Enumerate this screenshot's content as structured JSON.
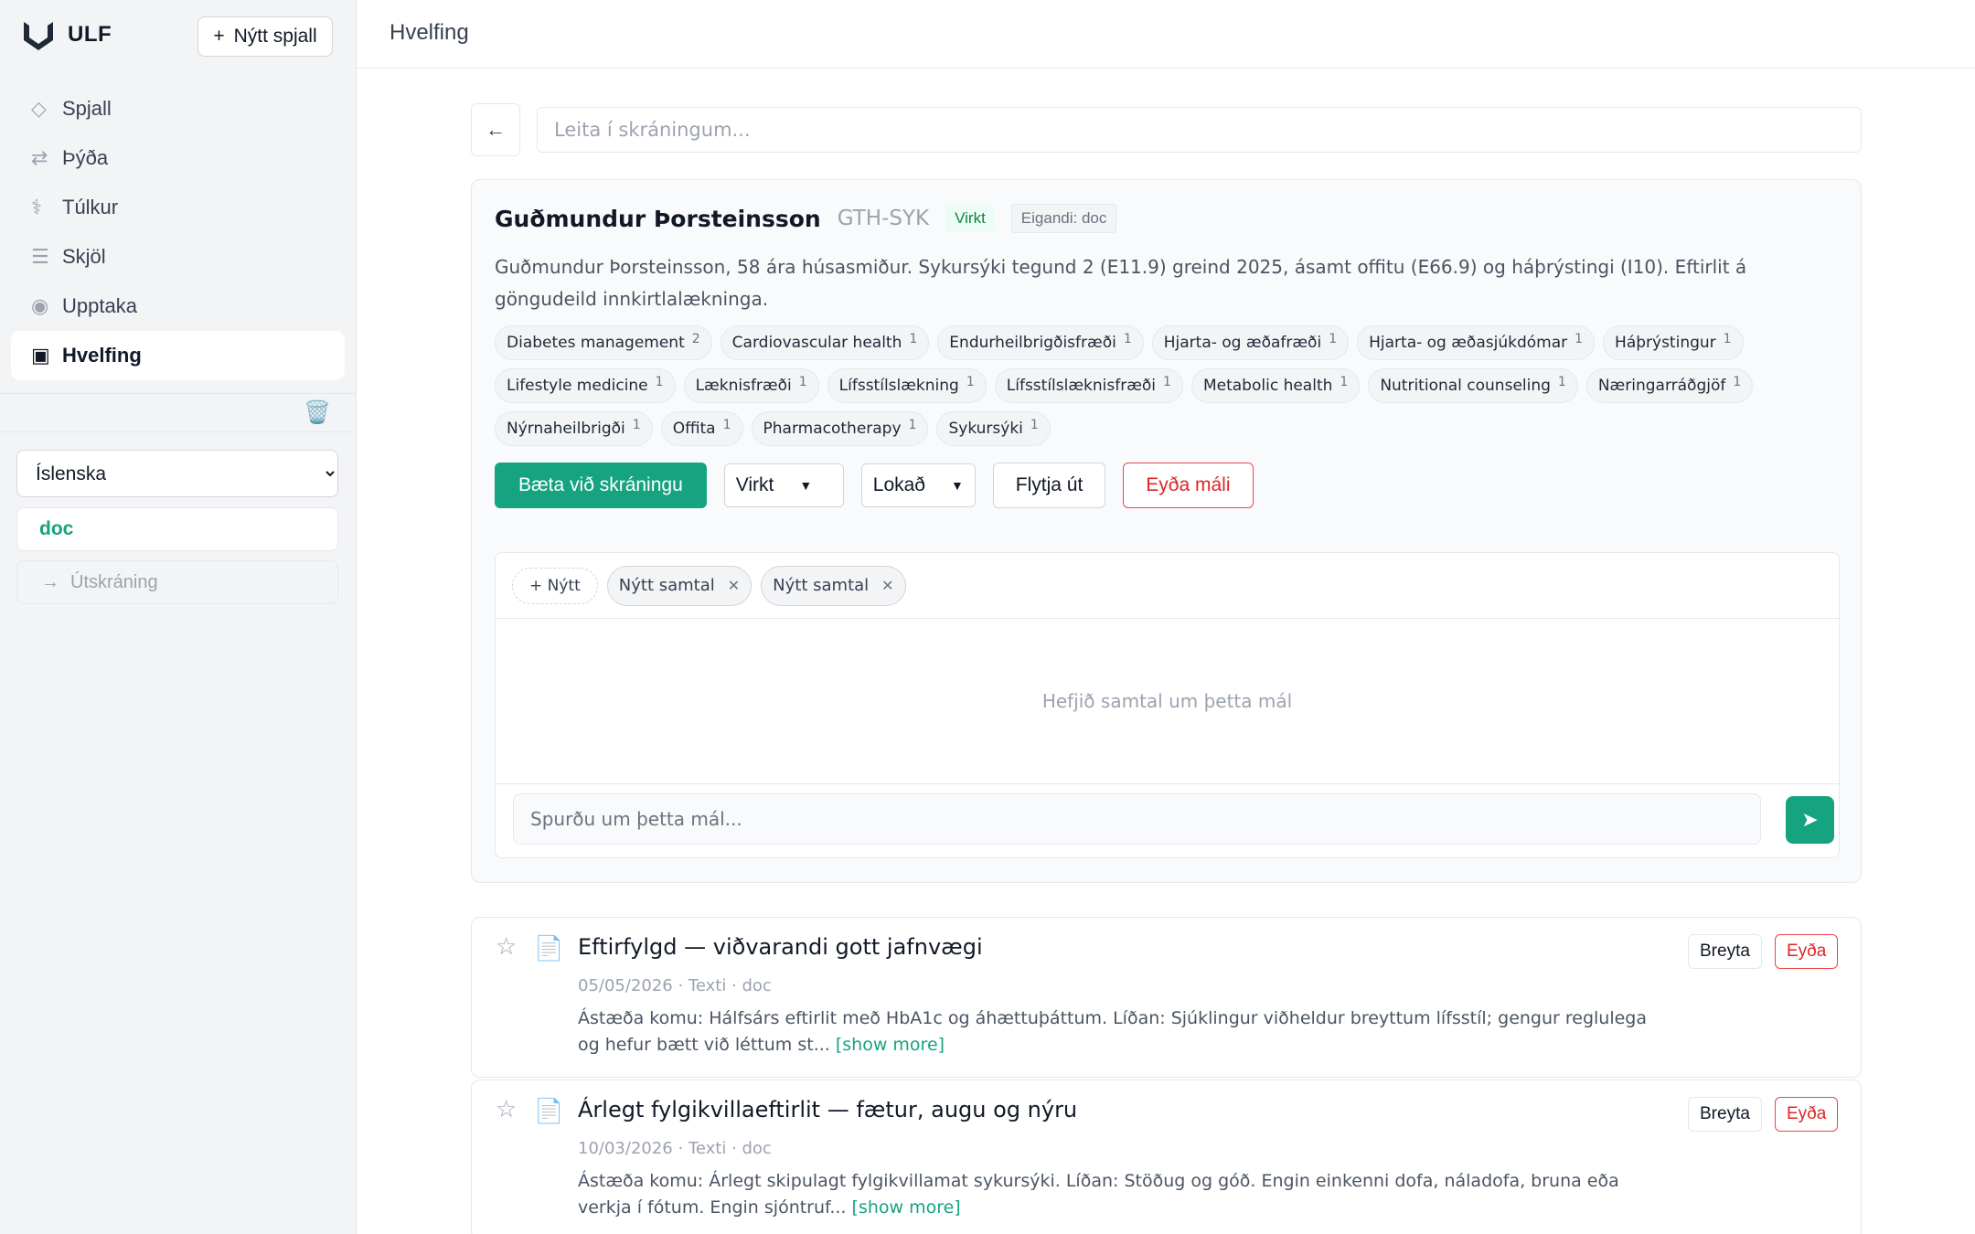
{
  "sidebar": {
    "brand": "ULF",
    "new_chat": "Nýtt spjall",
    "items": [
      {
        "label": "Spjall",
        "icon": "◇"
      },
      {
        "label": "Þýða",
        "icon": "⇄"
      },
      {
        "label": "Túlkur",
        "icon": "⚕"
      },
      {
        "label": "Skjöl",
        "icon": "☰"
      },
      {
        "label": "Upptaka",
        "icon": "◉"
      },
      {
        "label": "Hvelfing",
        "icon": "▣"
      }
    ],
    "language": "Íslenska",
    "user": "doc",
    "logout": "Útskráning"
  },
  "header": {
    "title": "Hvelfing"
  },
  "search": {
    "placeholder": "Leita í skráningum..."
  },
  "case": {
    "name": "Guðmundur Þorsteinsson",
    "code": "GTH-SYK",
    "status": "Virkt",
    "owner": "Eigandi: doc",
    "description": "Guðmundur Þorsteinsson, 58 ára húsasmiður. Sykursýki tegund 2 (E11.9) greind 2025, ásamt offitu (E66.9) og háþrýstingi (I10). Eftirlit á göngudeild innkirtlalækninga.",
    "tags": [
      {
        "label": "Diabetes management",
        "count": "2"
      },
      {
        "label": "Cardiovascular health",
        "count": "1"
      },
      {
        "label": "Endurheilbrigðisfræði",
        "count": "1"
      },
      {
        "label": "Hjarta- og æðafræði",
        "count": "1"
      },
      {
        "label": "Hjarta- og æðasjúkdómar",
        "count": "1"
      },
      {
        "label": "Háþrýstingur",
        "count": "1"
      },
      {
        "label": "Lifestyle medicine",
        "count": "1"
      },
      {
        "label": "Læknisfræði",
        "count": "1"
      },
      {
        "label": "Lífsstílslækning",
        "count": "1"
      },
      {
        "label": "Lífsstílslæknisfræði",
        "count": "1"
      },
      {
        "label": "Metabolic health",
        "count": "1"
      },
      {
        "label": "Nutritional counseling",
        "count": "1"
      },
      {
        "label": "Næringarráðgjöf",
        "count": "1"
      },
      {
        "label": "Nýrnaheilbrigði",
        "count": "1"
      },
      {
        "label": "Offita",
        "count": "1"
      },
      {
        "label": "Pharmacotherapy",
        "count": "1"
      },
      {
        "label": "Sykursýki",
        "count": "1"
      }
    ],
    "actions": {
      "add_entry": "Bæta við skráningu",
      "status_select": "Virkt",
      "access_select": "Lokað",
      "export": "Flytja út",
      "delete_case": "Eyða máli"
    }
  },
  "chat": {
    "new_label": "+ Nýtt",
    "tabs": [
      "Nýtt samtal",
      "Nýtt samtal"
    ],
    "empty": "Hefjið samtal um þetta mál",
    "placeholder": "Spurðu um þetta mál..."
  },
  "entries": [
    {
      "title": "Eftirfylgd — viðvarandi gott jafnvægi",
      "meta": "05/05/2026 · Texti · doc",
      "body": "Ástæða komu: Hálfsárs eftirlit með HbA1c og áhættuþáttum. Líðan: Sjúklingur viðheldur breyttum lífsstíl; gengur reglulega og hefur bætt við léttum st...",
      "more": "[show more]",
      "edit": "Breyta",
      "delete": "Eyða"
    },
    {
      "title": "Árlegt fylgikvillaeftirlit — fætur, augu og nýru",
      "meta": "10/03/2026 · Texti · doc",
      "body": "Ástæða komu: Árlegt skipulagt fylgikvillamat sykursýki. Líðan: Stöðug og góð. Engin einkenni dofa, náladofa, bruna eða verkja í fótum. Engin sjóntruf...",
      "more": "[show more]",
      "edit": "Breyta",
      "delete": "Eyða"
    }
  ],
  "colors": {
    "accent": "#16a37f",
    "danger": "#dc2626",
    "sidebar_bg": "#f3f4f6"
  }
}
